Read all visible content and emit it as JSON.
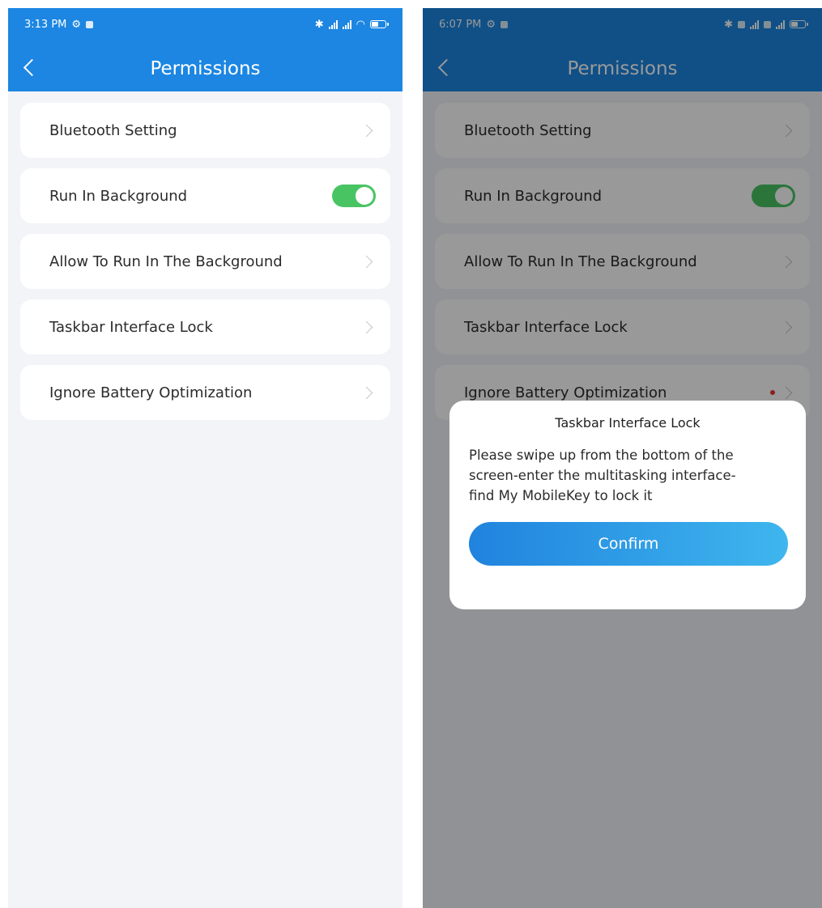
{
  "left_screen": {
    "status": {
      "time": "3:13 PM"
    },
    "header": {
      "title": "Permissions"
    },
    "items": [
      {
        "label": "Bluetooth Setting"
      },
      {
        "label": "Run In Background"
      },
      {
        "label": "Allow To Run In The Background"
      },
      {
        "label": "Taskbar Interface Lock"
      },
      {
        "label": "Ignore Battery Optimization"
      }
    ],
    "run_in_background_enabled": true
  },
  "right_screen": {
    "status": {
      "time": "6:07 PM"
    },
    "header": {
      "title": "Permissions"
    },
    "items": [
      {
        "label": "Bluetooth Setting"
      },
      {
        "label": "Run In Background"
      },
      {
        "label": "Allow To Run In The Background"
      },
      {
        "label": "Taskbar Interface Lock"
      },
      {
        "label": "Ignore Battery Optimization"
      }
    ],
    "run_in_background_enabled": true,
    "dialog": {
      "title": "Taskbar Interface Lock",
      "message": "Please swipe up from the bottom of the screen-enter the multitasking interface-find My MobileKey to lock it",
      "confirm_label": "Confirm"
    }
  },
  "colors": {
    "accent": "#1c86e2",
    "toggle_on": "#49c463",
    "alert_dot": "#e53935"
  },
  "icons": [
    "back-icon",
    "chevron-right-icon",
    "bluetooth-icon",
    "signal-icon",
    "wifi-icon",
    "battery-icon"
  ]
}
